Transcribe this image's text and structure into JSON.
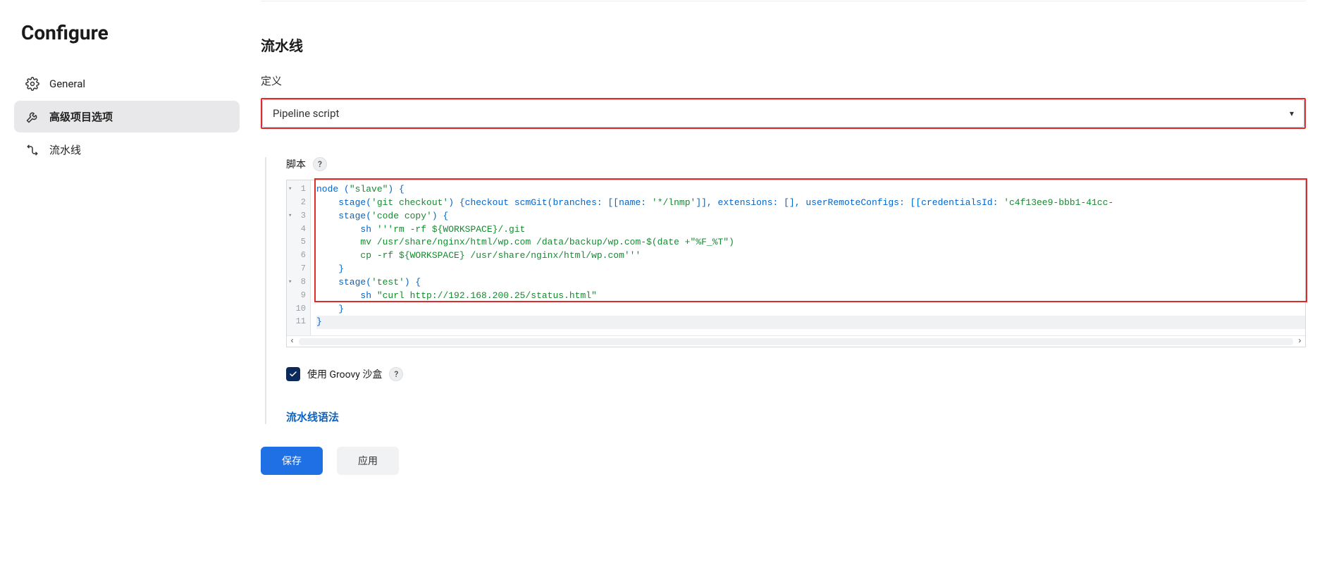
{
  "sidebar": {
    "title": "Configure",
    "items": [
      {
        "label": "General",
        "icon": "gear"
      },
      {
        "label": "高级项目选项",
        "icon": "wrench"
      },
      {
        "label": "流水线",
        "icon": "pipeline"
      }
    ],
    "active_index": 1
  },
  "main": {
    "section_title": "流水线",
    "definition_label": "定义",
    "definition_value": "Pipeline script",
    "script_label": "脚本",
    "help_symbol": "?",
    "sandbox_label": "使用 Groovy 沙盒",
    "sandbox_checked": true,
    "syntax_link": "流水线语法",
    "save_button": "保存",
    "apply_button": "应用",
    "code_lines": [
      {
        "n": 1,
        "fold": true,
        "segments": [
          {
            "t": "node (",
            "c": "kw"
          },
          {
            "t": "\"slave\"",
            "c": "str"
          },
          {
            "t": ") {",
            "c": "kw"
          }
        ]
      },
      {
        "n": 2,
        "segments": [
          {
            "t": "    stage(",
            "c": "kw"
          },
          {
            "t": "'git checkout'",
            "c": "str"
          },
          {
            "t": ") {checkout scmGit(branches: [[name: ",
            "c": "kw"
          },
          {
            "t": "'*/lnmp'",
            "c": "str"
          },
          {
            "t": "]], extensions: [], userRemoteConfigs: [[credentialsId: ",
            "c": "kw"
          },
          {
            "t": "'c4f13ee9-bbb1-41cc-",
            "c": "str"
          }
        ]
      },
      {
        "n": 3,
        "fold": true,
        "segments": [
          {
            "t": "    stage(",
            "c": "kw"
          },
          {
            "t": "'code copy'",
            "c": "str"
          },
          {
            "t": ") {",
            "c": "kw"
          }
        ]
      },
      {
        "n": 4,
        "segments": [
          {
            "t": "        sh ",
            "c": "kw"
          },
          {
            "t": "'''rm -rf ${WORKSPACE}/.git",
            "c": "str"
          }
        ]
      },
      {
        "n": 5,
        "segments": [
          {
            "t": "        mv /usr/share/nginx/html/wp.com /data/backup/wp.com-$(date +\"%F_%T\")",
            "c": "str"
          }
        ]
      },
      {
        "n": 6,
        "segments": [
          {
            "t": "        cp -rf ${WORKSPACE} /usr/share/nginx/html/wp.com'''",
            "c": "str"
          }
        ]
      },
      {
        "n": 7,
        "segments": [
          {
            "t": "    }",
            "c": "kw"
          }
        ]
      },
      {
        "n": 8,
        "fold": true,
        "segments": [
          {
            "t": "    stage(",
            "c": "kw"
          },
          {
            "t": "'test'",
            "c": "str"
          },
          {
            "t": ") {",
            "c": "kw"
          }
        ]
      },
      {
        "n": 9,
        "segments": [
          {
            "t": "        sh ",
            "c": "kw"
          },
          {
            "t": "\"curl http://192.168.200.25/status.html\"",
            "c": "str"
          }
        ]
      },
      {
        "n": 10,
        "segments": [
          {
            "t": "    }",
            "c": "kw"
          }
        ]
      },
      {
        "n": 11,
        "active": true,
        "segments": [
          {
            "t": "}",
            "c": "kw"
          }
        ]
      }
    ]
  },
  "colors": {
    "highlight_red": "#e12b2b",
    "primary_blue": "#1f6fe5",
    "link_blue": "#0b63c4",
    "checkbox_navy": "#0b2a5b",
    "string_green": "#168a30"
  }
}
